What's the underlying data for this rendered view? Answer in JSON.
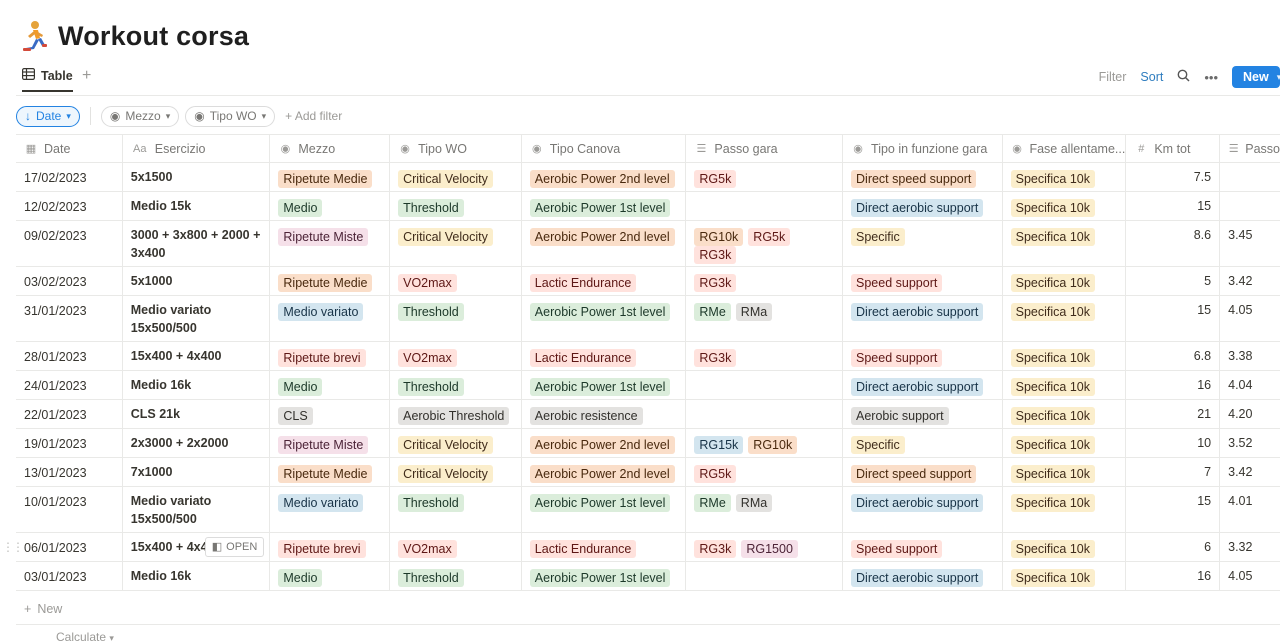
{
  "page": {
    "title": "Workout corsa"
  },
  "view": {
    "tab_label": "Table",
    "filter_label": "Filter",
    "sort_label": "Sort",
    "new_label": "New"
  },
  "filters": {
    "date": "Date",
    "mezzo": "Mezzo",
    "tipo_wo": "Tipo WO",
    "add_filter": "Add filter"
  },
  "columns": {
    "date": "Date",
    "esercizio": "Esercizio",
    "mezzo": "Mezzo",
    "tipo_wo": "Tipo WO",
    "tipo_canova": "Tipo Canova",
    "passo_gara": "Passo gara",
    "tipo_funzione": "Tipo in funzione gara",
    "fase": "Fase allentame...",
    "km_tot": "Km tot",
    "passo": "Passo"
  },
  "rows": [
    {
      "date": "17/02/2023",
      "esercizio": "5x1500",
      "mezzo": "Ripetute Medie",
      "tipo_wo": "Critical Velocity",
      "canova": "Aerobic Power 2nd level",
      "passo_gara": [
        "RG5k"
      ],
      "funzione": "Direct speed support",
      "fase": "Specifica 10k",
      "km": "7.5",
      "passo": ""
    },
    {
      "date": "12/02/2023",
      "esercizio": "Medio 15k",
      "mezzo": "Medio",
      "tipo_wo": "Threshold",
      "canova": "Aerobic Power 1st level",
      "passo_gara": [],
      "funzione": "Direct aerobic support",
      "fase": "Specifica 10k",
      "km": "15",
      "passo": ""
    },
    {
      "date": "09/02/2023",
      "esercizio": "3000 + 3x800 + 2000 + 3x400",
      "mezzo": "Ripetute Miste",
      "tipo_wo": "Critical Velocity",
      "canova": "Aerobic Power 2nd level",
      "passo_gara": [
        "RG10k",
        "RG5k",
        "RG3k"
      ],
      "funzione": "Specific",
      "fase": "Specifica 10k",
      "km": "8.6",
      "passo": "3.45"
    },
    {
      "date": "03/02/2023",
      "esercizio": "5x1000",
      "mezzo": "Ripetute Medie",
      "tipo_wo": "VO2max",
      "canova": "Lactic Endurance",
      "passo_gara": [
        "RG3k"
      ],
      "funzione": "Speed support",
      "fase": "Specifica 10k",
      "km": "5",
      "passo": "3.42"
    },
    {
      "date": "31/01/2023",
      "esercizio": "Medio variato 15x500/500",
      "mezzo": "Medio variato",
      "tipo_wo": "Threshold",
      "canova": "Aerobic Power 1st level",
      "passo_gara": [
        "RMe",
        "RMa"
      ],
      "funzione": "Direct aerobic support",
      "fase": "Specifica 10k",
      "km": "15",
      "passo": "4.05"
    },
    {
      "date": "28/01/2023",
      "esercizio": "15x400 + 4x400",
      "mezzo": "Ripetute brevi",
      "tipo_wo": "VO2max",
      "canova": "Lactic Endurance",
      "passo_gara": [
        "RG3k"
      ],
      "funzione": "Speed support",
      "fase": "Specifica 10k",
      "km": "6.8",
      "passo": "3.38"
    },
    {
      "date": "24/01/2023",
      "esercizio": "Medio 16k",
      "mezzo": "Medio",
      "tipo_wo": "Threshold",
      "canova": "Aerobic Power 1st level",
      "passo_gara": [],
      "funzione": "Direct aerobic support",
      "fase": "Specifica 10k",
      "km": "16",
      "passo": "4.04"
    },
    {
      "date": "22/01/2023",
      "esercizio": "CLS 21k",
      "mezzo": "CLS",
      "tipo_wo": "Aerobic Threshold",
      "canova": "Aerobic resistence",
      "passo_gara": [],
      "funzione": "Aerobic support",
      "fase": "Specifica 10k",
      "km": "21",
      "passo": "4.20"
    },
    {
      "date": "19/01/2023",
      "esercizio": "2x3000 + 2x2000",
      "mezzo": "Ripetute Miste",
      "tipo_wo": "Critical Velocity",
      "canova": "Aerobic Power 2nd level",
      "passo_gara": [
        "RG15k",
        "RG10k"
      ],
      "funzione": "Specific",
      "fase": "Specifica 10k",
      "km": "10",
      "passo": "3.52"
    },
    {
      "date": "13/01/2023",
      "esercizio": "7x1000",
      "mezzo": "Ripetute Medie",
      "tipo_wo": "Critical Velocity",
      "canova": "Aerobic Power 2nd level",
      "passo_gara": [
        "RG5k"
      ],
      "funzione": "Direct speed support",
      "fase": "Specifica 10k",
      "km": "7",
      "passo": "3.42"
    },
    {
      "date": "10/01/2023",
      "esercizio": "Medio variato 15x500/500",
      "mezzo": "Medio variato",
      "tipo_wo": "Threshold",
      "canova": "Aerobic Power 1st level",
      "passo_gara": [
        "RMe",
        "RMa"
      ],
      "funzione": "Direct aerobic support",
      "fase": "Specifica 10k",
      "km": "15",
      "passo": "4.01"
    },
    {
      "date": "06/01/2023",
      "esercizio": "15x400 + 4x400",
      "mezzo": "Ripetute brevi",
      "tipo_wo": "VO2max",
      "canova": "Lactic Endurance",
      "passo_gara": [
        "RG3k",
        "RG1500"
      ],
      "funzione": "Speed support",
      "fase": "Specifica 10k",
      "km": "6",
      "passo": "3.32",
      "hover": true
    },
    {
      "date": "03/01/2023",
      "esercizio": "Medio 16k",
      "mezzo": "Medio",
      "tipo_wo": "Threshold",
      "canova": "Aerobic Power 1st level",
      "passo_gara": [],
      "funzione": "Direct aerobic support",
      "fase": "Specifica 10k",
      "km": "16",
      "passo": "4.05"
    }
  ],
  "hover_open_label": "OPEN",
  "footer": {
    "new_label": "New",
    "calculate_label": "Calculate"
  },
  "tag_colors": {
    "orange": {
      "bg": "#fadec9",
      "fg": "#49290e"
    },
    "yellow": {
      "bg": "#fbeecc",
      "fg": "#402c1b"
    },
    "green": {
      "bg": "#dbeddb",
      "fg": "#1c3829"
    },
    "red": {
      "bg": "#ffe2dd",
      "fg": "#5d1715"
    },
    "pink": {
      "bg": "#f5e0e9",
      "fg": "#4c2337"
    },
    "blue": {
      "bg": "#d3e5ef",
      "fg": "#183347"
    },
    "gray": {
      "bg": "#e3e2e0",
      "fg": "#32302c"
    }
  },
  "value_colors": {
    "Ripetute Medie": "orange",
    "Medio": "green",
    "Ripetute Miste": "pink",
    "Medio variato": "blue",
    "Ripetute brevi": "red",
    "CLS": "gray",
    "Critical Velocity": "yellow",
    "Threshold": "green",
    "VO2max": "red",
    "Aerobic Threshold": "gray",
    "Aerobic Power 2nd level": "orange",
    "Aerobic Power 1st level": "green",
    "Lactic Endurance": "red",
    "Aerobic resistence": "gray",
    "RG5k": "red",
    "RG10k": "orange",
    "RG3k": "red",
    "RMe": "green",
    "RMa": "gray",
    "RG15k": "blue",
    "RG1500": "pink",
    "Direct speed support": "orange",
    "Direct aerobic support": "blue",
    "Specific": "yellow",
    "Speed support": "red",
    "Aerobic support": "gray",
    "Specifica 10k": "yellow"
  }
}
